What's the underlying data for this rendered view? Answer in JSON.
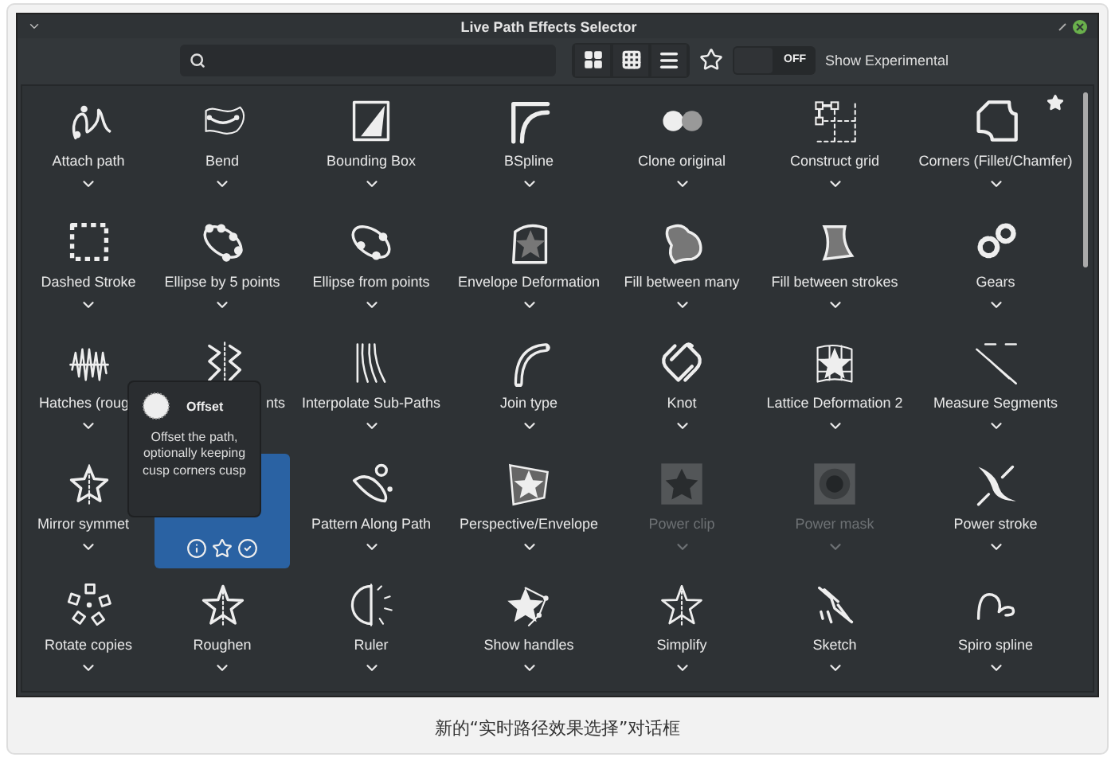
{
  "window": {
    "title": "Live Path Effects Selector"
  },
  "toolbar": {
    "toggle": {
      "label": "OFF",
      "on": false
    },
    "experimental_label": "Show Experimental"
  },
  "effects": [
    {
      "label": "Attach path",
      "kind": "effect",
      "selected": false,
      "disabled": false,
      "favorite": false
    },
    {
      "label": "Bend",
      "kind": "effect",
      "selected": false,
      "disabled": false,
      "favorite": false
    },
    {
      "label": "Bounding Box",
      "kind": "effect",
      "selected": false,
      "disabled": false,
      "favorite": false
    },
    {
      "label": "BSpline",
      "kind": "effect",
      "selected": false,
      "disabled": false,
      "favorite": false
    },
    {
      "label": "Clone original",
      "kind": "effect",
      "selected": false,
      "disabled": false,
      "favorite": false
    },
    {
      "label": "Construct grid",
      "kind": "effect",
      "selected": false,
      "disabled": false,
      "favorite": false
    },
    {
      "label": "Corners (Fillet/Chamfer)",
      "kind": "effect",
      "selected": false,
      "disabled": false,
      "favorite": true
    },
    {
      "label": "Dashed Stroke",
      "kind": "effect",
      "selected": false,
      "disabled": false,
      "favorite": false
    },
    {
      "label": "Ellipse by 5 points",
      "kind": "effect",
      "selected": false,
      "disabled": false,
      "favorite": false
    },
    {
      "label": "Ellipse from points",
      "kind": "effect",
      "selected": false,
      "disabled": false,
      "favorite": false
    },
    {
      "label": "Envelope Deformation",
      "kind": "effect",
      "selected": false,
      "disabled": false,
      "favorite": false
    },
    {
      "label": "Fill between many",
      "kind": "effect",
      "selected": false,
      "disabled": false,
      "favorite": false
    },
    {
      "label": "Fill between strokes",
      "kind": "effect",
      "selected": false,
      "disabled": false,
      "favorite": false
    },
    {
      "label": "Gears",
      "kind": "effect",
      "selected": false,
      "disabled": false,
      "favorite": false
    },
    {
      "label": "Hatches (roug",
      "kind": "cut_right",
      "selected": false,
      "disabled": false,
      "favorite": false
    },
    {
      "label": "nts",
      "kind": "cut_left",
      "selected": false,
      "disabled": false,
      "favorite": false
    },
    {
      "label": "Interpolate Sub-Paths",
      "kind": "effect",
      "selected": false,
      "disabled": false,
      "favorite": false
    },
    {
      "label": "Join type",
      "kind": "effect",
      "selected": false,
      "disabled": false,
      "favorite": false
    },
    {
      "label": "Knot",
      "kind": "effect",
      "selected": false,
      "disabled": false,
      "favorite": false
    },
    {
      "label": "Lattice Deformation 2",
      "kind": "effect",
      "selected": false,
      "disabled": false,
      "favorite": false
    },
    {
      "label": "Measure Segments",
      "kind": "effect",
      "selected": false,
      "disabled": false,
      "favorite": false
    },
    {
      "label": "Mirror symmet",
      "kind": "cut_right",
      "selected": false,
      "disabled": false,
      "favorite": false
    },
    {
      "kind": "hidden",
      "selected": true,
      "favorite": false
    },
    {
      "label": "Pattern Along Path",
      "kind": "effect",
      "selected": false,
      "disabled": false,
      "favorite": false
    },
    {
      "label": "Perspective/Envelope",
      "kind": "effect",
      "selected": false,
      "disabled": false,
      "favorite": false
    },
    {
      "label": "Power clip",
      "kind": "effect",
      "selected": false,
      "disabled": true,
      "favorite": false
    },
    {
      "label": "Power mask",
      "kind": "effect",
      "selected": false,
      "disabled": true,
      "favorite": false
    },
    {
      "label": "Power stroke",
      "kind": "effect",
      "selected": false,
      "disabled": false,
      "favorite": false
    },
    {
      "label": "Rotate copies",
      "kind": "effect",
      "selected": false,
      "disabled": false,
      "favorite": false
    },
    {
      "label": "Roughen",
      "kind": "effect",
      "selected": false,
      "disabled": false,
      "favorite": false
    },
    {
      "label": "Ruler",
      "kind": "effect",
      "selected": false,
      "disabled": false,
      "favorite": false
    },
    {
      "label": "Show handles",
      "kind": "effect",
      "selected": false,
      "disabled": false,
      "favorite": false
    },
    {
      "label": "Simplify",
      "kind": "effect",
      "selected": false,
      "disabled": false,
      "favorite": false
    },
    {
      "label": "Sketch",
      "kind": "effect",
      "selected": false,
      "disabled": false,
      "favorite": false
    },
    {
      "label": "Spiro spline",
      "kind": "effect",
      "selected": false,
      "disabled": false,
      "favorite": false
    }
  ],
  "tooltip": {
    "title": "Offset",
    "description": "Offset the path, optionally keeping cusp corners cusp"
  },
  "caption": "新的“实时路径效果选择”对话框"
}
